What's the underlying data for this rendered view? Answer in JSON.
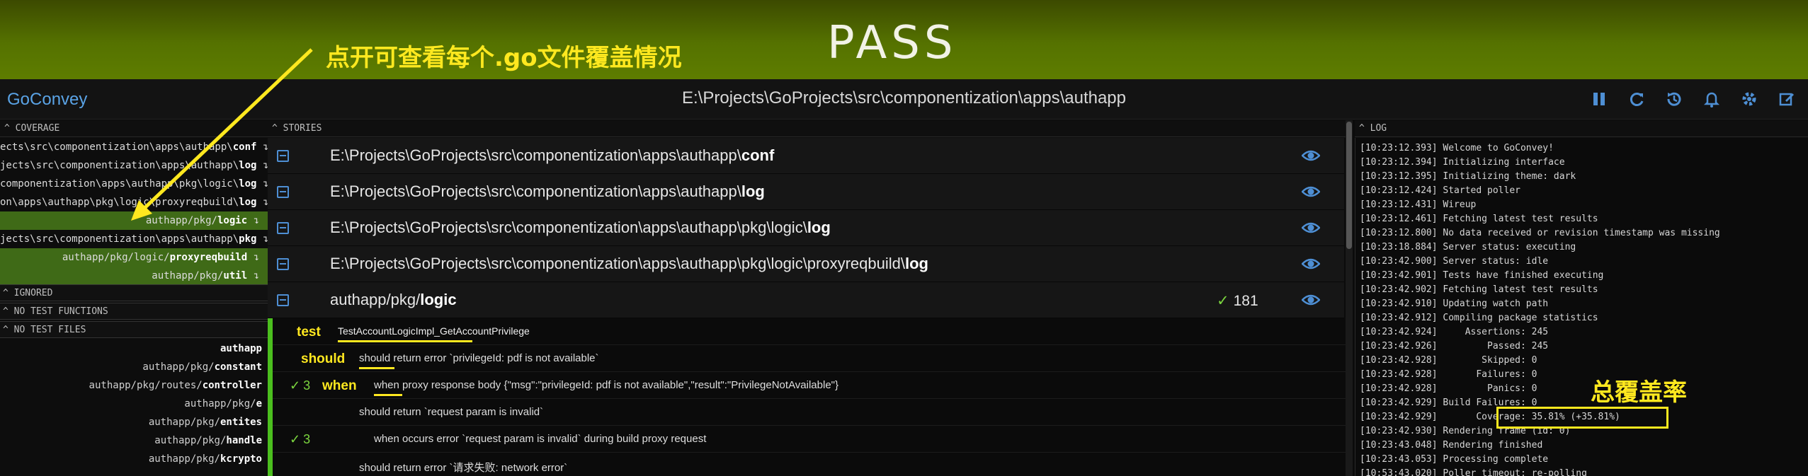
{
  "banner": {
    "status": "PASS",
    "annotation_coverage_files": "点开可查看每个.go文件覆盖情况",
    "annotation_total_coverage": "总覆盖率"
  },
  "header": {
    "app_title": "GoConvey",
    "path": "E:\\Projects\\GoProjects\\src\\componentization\\apps\\authapp",
    "icons": [
      "pause-icon",
      "refresh-icon",
      "history-icon",
      "bell-icon",
      "gear-icon",
      "edit-icon"
    ]
  },
  "coverage_panel": {
    "title": "COVERAGE",
    "rows": [
      {
        "prefix": "ects\\src\\componentization\\apps\\authapp\\",
        "name": "conf",
        "highlight": false
      },
      {
        "prefix": "jects\\src\\componentization\\apps\\authapp\\",
        "name": "log",
        "highlight": false
      },
      {
        "prefix": "componentization\\apps\\authapp\\pkg\\logic\\",
        "name": "log",
        "highlight": false
      },
      {
        "prefix": "on\\apps\\authapp\\pkg\\logic\\proxyreqbuild\\",
        "name": "log",
        "highlight": false
      },
      {
        "prefix": "authapp/pkg/",
        "name": "logic",
        "highlight": true
      },
      {
        "prefix": "jects\\src\\componentization\\apps\\authapp\\",
        "name": "pkg",
        "highlight": false
      },
      {
        "prefix": "authapp/pkg/logic/",
        "name": "proxyreqbuild",
        "highlight": true
      },
      {
        "prefix": "authapp/pkg/",
        "name": "util",
        "highlight": true
      }
    ],
    "ignored_title": "IGNORED",
    "no_test_functions_title": "NO TEST FUNCTIONS",
    "no_test_files_title": "NO TEST FILES",
    "no_test_files": [
      {
        "prefix": "",
        "name": "authapp"
      },
      {
        "prefix": "authapp/pkg/",
        "name": "constant"
      },
      {
        "prefix": "authapp/pkg/routes/",
        "name": "controller"
      },
      {
        "prefix": "authapp/pkg/",
        "name": "e"
      },
      {
        "prefix": "authapp/pkg/",
        "name": "entites"
      },
      {
        "prefix": "authapp/pkg/",
        "name": "handle"
      },
      {
        "prefix": "authapp/pkg/",
        "name": "kcrypto"
      }
    ]
  },
  "stories_panel": {
    "title": "STORIES",
    "packages": [
      {
        "prefix": "E:\\Projects\\GoProjects\\src\\componentization\\apps\\authapp\\",
        "name": "conf",
        "passed": ""
      },
      {
        "prefix": "E:\\Projects\\GoProjects\\src\\componentization\\apps\\authapp\\",
        "name": "log",
        "passed": ""
      },
      {
        "prefix": "E:\\Projects\\GoProjects\\src\\componentization\\apps\\authapp\\pkg\\logic\\",
        "name": "log",
        "passed": ""
      },
      {
        "prefix": "E:\\Projects\\GoProjects\\src\\componentization\\apps\\authapp\\pkg\\logic\\proxyreqbuild\\",
        "name": "log",
        "passed": ""
      },
      {
        "prefix": "authapp/pkg/",
        "name": "logic",
        "check": "✓",
        "passed": "181"
      }
    ],
    "story_lines": [
      {
        "keyword": "test",
        "text": "TestAccountLogicImpl_GetAccountPrivilege",
        "count": ""
      },
      {
        "keyword": "should",
        "text": "should return error `privilegeId: pdf is not available`",
        "count": ""
      },
      {
        "keyword": "when",
        "text": "when proxy response body {\"msg\":\"privilegeId: pdf is not available\",\"result\":\"PrivilegeNotAvailable\"}",
        "count": "3"
      },
      {
        "keyword": "",
        "text": "should return `request param is invalid`",
        "count": ""
      },
      {
        "keyword": "",
        "text": "when occurs error `request param is invalid` during build proxy request",
        "count": "3"
      },
      {
        "keyword": "",
        "text": "should return error `请求失败: network error`",
        "count": ""
      }
    ],
    "check_symbol": "✓"
  },
  "log_panel": {
    "title": "LOG",
    "lines": [
      "[10:23:12.393] Welcome to GoConvey!",
      "[10:23:12.394] Initializing interface",
      "[10:23:12.395] Initializing theme: dark",
      "[10:23:12.424] Started poller",
      "[10:23:12.431] Wireup",
      "[10:23:12.461] Fetching latest test results",
      "[10:23:12.800] No data received or revision timestamp was missing",
      "[10:23:18.884] Server status: executing",
      "[10:23:42.900] Server status: idle",
      "[10:23:42.901] Tests have finished executing",
      "[10:23:42.902] Fetching latest test results",
      "[10:23:42.910] Updating watch path",
      "[10:23:42.912] Compiling package statistics",
      "[10:23:42.924]     Assertions: 245",
      "[10:23:42.926]         Passed: 245",
      "[10:23:42.928]        Skipped: 0",
      "[10:23:42.928]       Failures: 0",
      "[10:23:42.928]         Panics: 0",
      "[10:23:42.929] Build Failures: 0",
      "[10:23:42.929]       Coverage: 35.81% (+35.81%)",
      "[10:23:42.930] Rendering frame (id: 0)",
      "[10:23:43.048] Rendering finished",
      "[10:23:43.053] Processing complete",
      "[10:53:43.020] Poller timeout; re-polling"
    ]
  },
  "colors": {
    "banner_pass": "#5e7d00",
    "accent_blue": "#4e8fd4",
    "coverage_highlight": "#3f6a17",
    "annotation_yellow": "#ffe81f",
    "pass_green": "#7bd53f"
  }
}
